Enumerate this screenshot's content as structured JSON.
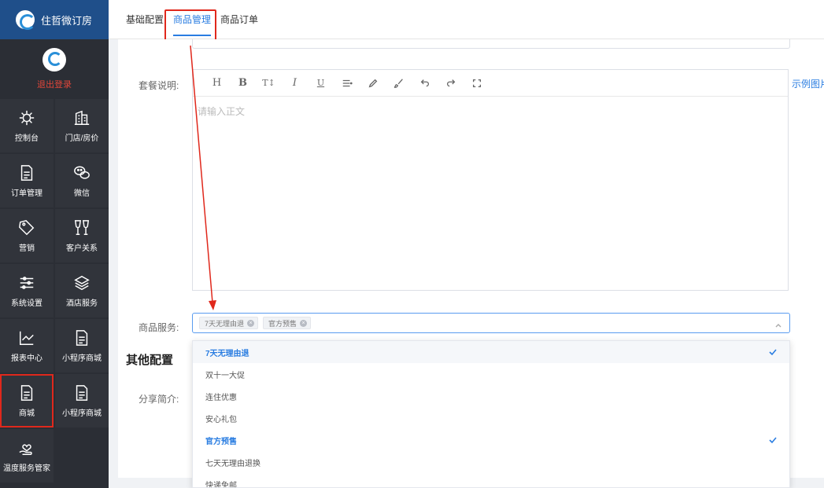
{
  "brand": {
    "title": "住哲微订房"
  },
  "user": {
    "logout_label": "退出登录"
  },
  "sidebar": {
    "items": [
      {
        "label": "控制台",
        "icon": "gear-icon"
      },
      {
        "label": "门店/房价",
        "icon": "building-icon"
      },
      {
        "label": "订单管理",
        "icon": "document-icon"
      },
      {
        "label": "微信",
        "icon": "wechat-icon"
      },
      {
        "label": "营销",
        "icon": "tag-icon"
      },
      {
        "label": "客户关系",
        "icon": "wine-glasses-icon"
      },
      {
        "label": "系统设置",
        "icon": "sliders-icon"
      },
      {
        "label": "酒店服务",
        "icon": "layers-icon"
      },
      {
        "label": "报表中心",
        "icon": "line-chart-icon"
      },
      {
        "label": "小程序商城",
        "icon": "document-icon"
      },
      {
        "label": "商城",
        "icon": "document-icon"
      },
      {
        "label": "小程序商城",
        "icon": "document-icon"
      },
      {
        "label": "温度服务管家",
        "icon": "hand-heart-icon"
      }
    ],
    "active_label": "商城"
  },
  "tabs": [
    {
      "label": "基础配置"
    },
    {
      "label": "商品管理"
    },
    {
      "label": "商品订单"
    }
  ],
  "active_tab": "商品管理",
  "form": {
    "package_label": "套餐说明:",
    "editor_placeholder": "请输入正文",
    "example_link": "示例图片",
    "service_label": "商品服务:",
    "selected_chips": [
      "7天无理由退",
      "官方预售"
    ],
    "other_section": "其他配置",
    "share_label": "分享简介:"
  },
  "toolbar_tools": [
    "heading-icon",
    "bold-icon",
    "font-size-icon",
    "italic-icon",
    "underline-icon",
    "align-icon",
    "pencil-icon",
    "brush-icon",
    "undo-icon",
    "redo-icon",
    "fullscreen-icon"
  ],
  "toolbar_glyphs": {
    "heading": "H",
    "bold": "B",
    "font_size": "T↕",
    "italic": "I",
    "underline": "U"
  },
  "dropdown": {
    "options": [
      {
        "label": "7天无理由退",
        "selected": true
      },
      {
        "label": "双十一大促",
        "selected": false
      },
      {
        "label": "连住优惠",
        "selected": false
      },
      {
        "label": "安心礼包",
        "selected": false
      },
      {
        "label": "官方预售",
        "selected": true
      },
      {
        "label": "七天无理由退换",
        "selected": false
      },
      {
        "label": "快递免邮",
        "selected": false
      }
    ]
  },
  "colors": {
    "accent": "#2a7de1",
    "annotation": "#e0281c",
    "sidebar": "#2b2e35",
    "brand_bar": "#1f4f8a"
  }
}
